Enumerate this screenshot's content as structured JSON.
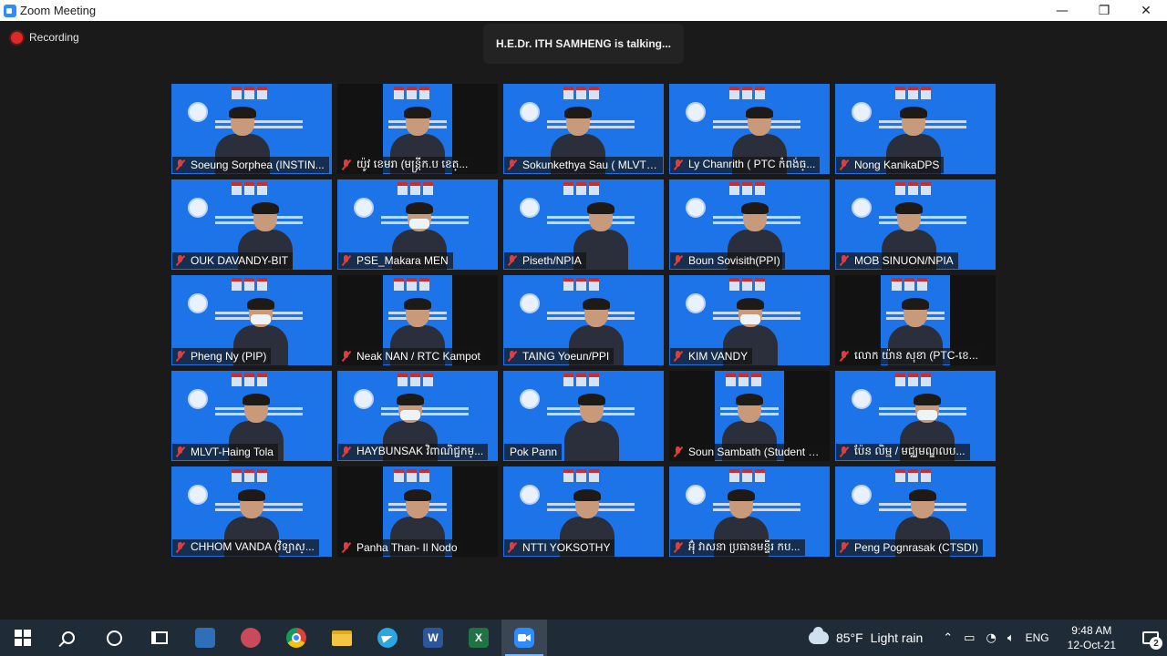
{
  "window": {
    "title": "Zoom Meeting",
    "controls": {
      "minimize": "—",
      "maximize": "❐",
      "close": "✕"
    }
  },
  "meeting": {
    "recording_label": "Recording",
    "talking_banner": "H.E.Dr. ITH SAMHENG is talking...",
    "participants": [
      {
        "name": "Soeung Sorphea (INSTIN...",
        "muted": true,
        "tile": "blue",
        "mask": false
      },
      {
        "name": "យ៉ូវ ខេមរា (មន្ត្រីក.ប ខេត្...",
        "muted": true,
        "tile": "dark",
        "mask": false
      },
      {
        "name": "Sokunkethya Sau ( MLVT/...",
        "muted": true,
        "tile": "blue",
        "mask": false
      },
      {
        "name": "Ly Chanrith ( PTC កំពង់ធ្...",
        "muted": true,
        "tile": "blue",
        "mask": false
      },
      {
        "name": "Nong KanikaDPS",
        "muted": true,
        "tile": "blue",
        "mask": false
      },
      {
        "name": "OUK DAVANDY-BIT",
        "muted": true,
        "tile": "blue",
        "mask": false
      },
      {
        "name": "PSE_Makara MEN",
        "muted": true,
        "tile": "blue",
        "mask": true
      },
      {
        "name": "Piseth/NPIA",
        "muted": true,
        "tile": "blue",
        "mask": false
      },
      {
        "name": "Boun Sovisith(PPI)",
        "muted": true,
        "tile": "blue",
        "mask": false
      },
      {
        "name": "MOB SINUON/NPIA",
        "muted": true,
        "tile": "blue",
        "mask": false
      },
      {
        "name": "Pheng Ny (PIP)",
        "muted": true,
        "tile": "blue",
        "mask": true
      },
      {
        "name": "Neak NAN  / RTC Kampot",
        "muted": true,
        "tile": "dark",
        "mask": false
      },
      {
        "name": "TAING Yoeun/PPI",
        "muted": true,
        "tile": "blue",
        "mask": false
      },
      {
        "name": "KIM VANDY",
        "muted": true,
        "tile": "blue",
        "mask": true
      },
      {
        "name": "លោក យ៉ាន សុខា (PTC-ខេ...",
        "muted": true,
        "tile": "dark",
        "mask": false
      },
      {
        "name": "MLVT-Haing Tola",
        "muted": true,
        "tile": "blue",
        "mask": false
      },
      {
        "name": "HAYBUNSAK វិពាណិជ្ជកម្...",
        "muted": true,
        "tile": "blue",
        "mask": true
      },
      {
        "name": "Pok Pann",
        "muted": false,
        "tile": "blue",
        "mask": false
      },
      {
        "name": "Soun Sambath (Student D...",
        "muted": true,
        "tile": "dark",
        "mask": false
      },
      {
        "name": "ប៉ែន លិម្ម / មជ្ឈមណ្ឌលប...",
        "muted": true,
        "tile": "blue",
        "mask": true
      },
      {
        "name": "CHHOM VANDA (វិទ្យាស្...",
        "muted": true,
        "tile": "blue",
        "mask": false
      },
      {
        "name": "Panha Than- Il Nodo",
        "muted": true,
        "tile": "dark",
        "mask": false
      },
      {
        "name": "NTTI YOKSOTHY",
        "muted": true,
        "tile": "blue",
        "mask": false
      },
      {
        "name": "អ៊ុំ វាសនា ប្រធានមន្ទីរ កប...",
        "muted": true,
        "tile": "blue",
        "mask": false
      },
      {
        "name": "Peng Pognrasak (CTSDI)",
        "muted": true,
        "tile": "blue",
        "mask": false
      }
    ]
  },
  "taskbar": {
    "apps": [
      {
        "name": "start",
        "icon": "windows-logo-icon"
      },
      {
        "name": "search",
        "icon": "search-icon"
      },
      {
        "name": "cortana",
        "icon": "cortana-circle-icon"
      },
      {
        "name": "task-view",
        "icon": "task-view-icon"
      },
      {
        "name": "store",
        "icon": "store-bag-icon"
      },
      {
        "name": "snipping",
        "icon": "snipping-tool-icon"
      },
      {
        "name": "chrome",
        "icon": "chrome-icon"
      },
      {
        "name": "file-explorer",
        "icon": "folder-icon"
      },
      {
        "name": "telegram",
        "icon": "telegram-icon"
      },
      {
        "name": "word",
        "icon": "word-icon",
        "letter": "W"
      },
      {
        "name": "excel",
        "icon": "excel-icon",
        "letter": "X"
      },
      {
        "name": "zoom",
        "icon": "zoom-camera-icon",
        "active": true
      }
    ],
    "weather": {
      "temp": "85°F",
      "condition": "Light rain"
    },
    "language": "ENG",
    "time": "9:48 AM",
    "date": "12-Oct-21",
    "notifications": "2"
  },
  "colors": {
    "meeting_bg": "#1a1a1a",
    "slide_blue": "#1d73e8",
    "mute_red": "#e23c3c",
    "recording_red": "#e02828",
    "taskbar_bg": "#1f2b36"
  }
}
